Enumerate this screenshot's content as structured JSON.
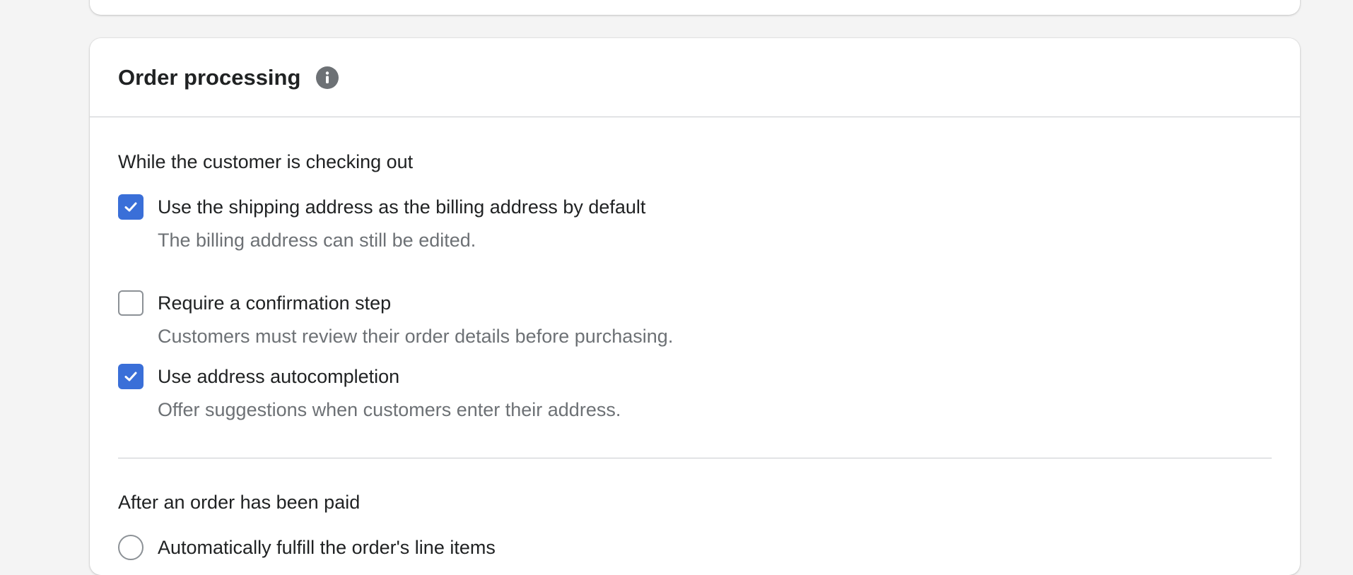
{
  "order_processing": {
    "title": "Order processing",
    "info_icon": "info-icon",
    "checkout_section": {
      "heading": "While the customer is checking out",
      "options": [
        {
          "label": "Use the shipping address as the billing address by default",
          "help": "The billing address can still be edited.",
          "checked": true
        },
        {
          "label": "Require a confirmation step",
          "help": "Customers must review their order details before purchasing.",
          "checked": false
        },
        {
          "label": "Use address autocompletion",
          "help": "Offer suggestions when customers enter their address.",
          "checked": true
        }
      ]
    },
    "paid_section": {
      "heading": "After an order has been paid",
      "first_option_label": "Automatically fulfill the order's line items"
    }
  },
  "colors": {
    "page_background": "#f4f4f4",
    "card_background": "#ffffff",
    "checkbox_checked": "#3a6fd8",
    "control_border": "#8c9196",
    "help_text": "#6d7175",
    "divider": "#c9cccf"
  }
}
